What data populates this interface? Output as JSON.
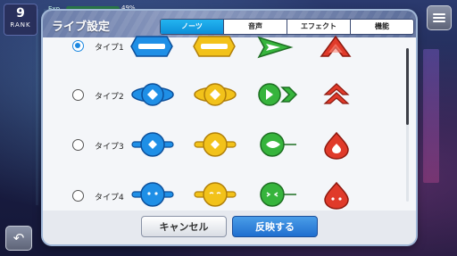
{
  "hud": {
    "rank_value": "9",
    "rank_label": "RANK",
    "exp_label": "Exp",
    "exp_percent": "49%",
    "exp_progress": 0.49
  },
  "dialog": {
    "title": "ライブ設定",
    "tabs": [
      {
        "label": "ノーツ",
        "active": true
      },
      {
        "label": "音声",
        "active": false
      },
      {
        "label": "エフェクト",
        "active": false
      },
      {
        "label": "機能",
        "active": false
      }
    ],
    "rows": [
      {
        "label": "タイプ1",
        "selected": true
      },
      {
        "label": "タイプ2",
        "selected": false
      },
      {
        "label": "タイプ3",
        "selected": false
      },
      {
        "label": "タイプ4",
        "selected": false
      }
    ],
    "note_colors": {
      "blue": "#1f8fe6",
      "yellow": "#f2c21a",
      "green": "#36b43c",
      "red": "#e03a2a"
    },
    "cancel_label": "キャンセル",
    "apply_label": "反映する"
  }
}
